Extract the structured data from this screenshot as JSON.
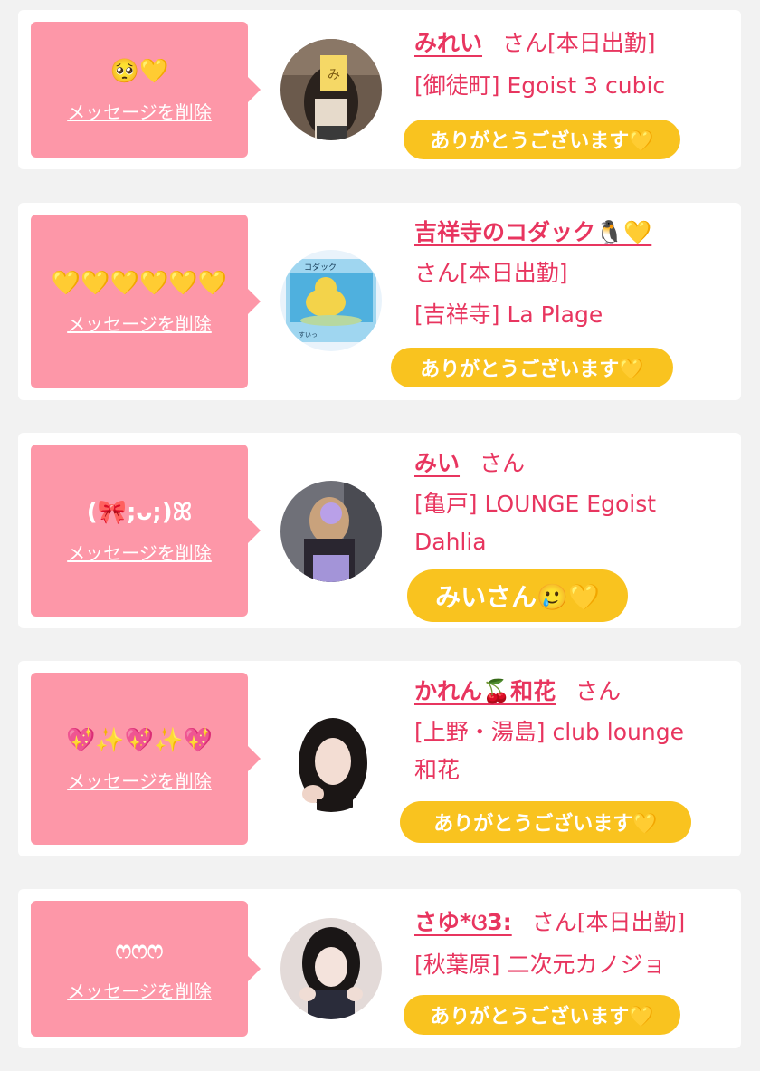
{
  "items": [
    {
      "bubble_message": "🥺💛",
      "delete_label": "メッセージを削除",
      "name": "みれい",
      "suffix": "さん[本日出勤]",
      "suffix2": "",
      "shop": "[御徒町] Egoist 3 cubic",
      "shop2": "",
      "reply": "ありがとうございます💛"
    },
    {
      "bubble_message": "💛💛💛💛💛💛",
      "delete_label": "メッセージを削除",
      "name": "吉祥寺のコダック🐧💛",
      "suffix": "",
      "suffix2": "さん[本日出勤]",
      "shop": "[吉祥寺] La Plage",
      "shop2": "",
      "reply": "ありがとうございます💛"
    },
    {
      "bubble_message": "(🎀;ᴗ;)ꕤ",
      "delete_label": "メッセージを削除",
      "name": "みい",
      "suffix": "さん",
      "suffix2": "",
      "shop": "[亀戸] LOUNGE Egoist",
      "shop2": "Dahlia",
      "reply": "みいさん🥲💛"
    },
    {
      "bubble_message": "💖✨💖✨💖",
      "delete_label": "メッセージを削除",
      "name": "かれん🍒和花",
      "suffix": "さん",
      "suffix2": "",
      "shop": "[上野・湯島] club lounge",
      "shop2": "和花",
      "reply": "ありがとうございます💛"
    },
    {
      "bubble_message": "ෆෆෆ",
      "delete_label": "メッセージを削除",
      "name": "さゆ*ଓ3:",
      "suffix": "さん[本日出勤]",
      "suffix2": "",
      "shop": "[秋葉原] 二次元カノジョ",
      "shop2": "",
      "reply": "ありがとうございます💛"
    }
  ],
  "avatar_labels": {
    "first_sticker": "み",
    "pokemon_card_name": "コダック",
    "pokemon_card_sub": "すいっ"
  },
  "colors": {
    "page_bg": "#f2f2f2",
    "card_bg": "#ffffff",
    "bubble_bg": "#fd97a8",
    "accent_text": "#e8355f",
    "reply_pill": "#f9c31f"
  }
}
